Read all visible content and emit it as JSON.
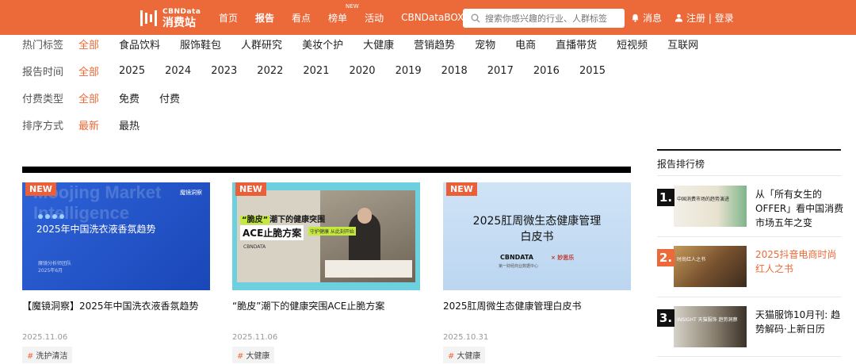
{
  "header": {
    "logo_en": "CBNData",
    "logo_cn": "消费站",
    "nav": [
      {
        "label": "首页",
        "active": false
      },
      {
        "label": "报告",
        "active": true
      },
      {
        "label": "看点",
        "active": false
      },
      {
        "label": "榜单",
        "active": false,
        "badge": "NEW"
      },
      {
        "label": "活动",
        "active": false
      },
      {
        "label": "CBNDataBOX",
        "active": false
      }
    ],
    "search_placeholder": "搜索你感兴趣的行业、人群标签",
    "messages": "消息",
    "login": "注册 | 登录"
  },
  "filters": [
    {
      "label": "热门标签",
      "options": [
        "全部",
        "食品饮料",
        "服饰鞋包",
        "人群研究",
        "美妆个护",
        "大健康",
        "营销趋势",
        "宠物",
        "电商",
        "直播带货",
        "短视频",
        "互联网"
      ],
      "selected": "全部"
    },
    {
      "label": "报告时间",
      "options": [
        "全部",
        "2025",
        "2024",
        "2023",
        "2022",
        "2021",
        "2020",
        "2019",
        "2018",
        "2017",
        "2016",
        "2015"
      ],
      "selected": "全部"
    },
    {
      "label": "付费类型",
      "options": [
        "全部",
        "免费",
        "付费"
      ],
      "selected": "全部"
    },
    {
      "label": "排序方式",
      "options": [
        "最新",
        "最热"
      ],
      "selected": "最新"
    }
  ],
  "reports": [
    {
      "badge": "NEW",
      "title": "【魔镜洞察】2025年中国洗衣液香氛趋势",
      "date": "2025.11.06",
      "tag": "洗护清洁",
      "thumb": {
        "ghost": "Moojing Market Intelligence",
        "headline": "2025年中国洗衣液香氛趋势",
        "logo": "魔镜洞察",
        "small1": "魔镜分析师团队",
        "small2": "2025年6月"
      }
    },
    {
      "badge": "NEW",
      "title": "“脆皮”潮下的健康突围ACE止脆方案",
      "date": "2025.11.06",
      "tag": "大健康",
      "thumb": {
        "line1_highlight": "“脆皮”",
        "line1_rest": "潮下的健康突围",
        "line2": "ACE止脆方案",
        "sub": "守护健康 从此刻开始",
        "brand": "CBNDATA"
      }
    },
    {
      "badge": "NEW",
      "title": "2025肛周微生态健康管理白皮书",
      "date": "2025.10.31",
      "tag": "大健康",
      "thumb": {
        "line1": "2025肛周微生态健康管理",
        "line2": "白皮书",
        "brand": "CBNDATA",
        "brand2": "×  妙思乐",
        "brand_sub": "第一财经商业数据中心"
      }
    }
  ],
  "sidebar": {
    "title": "报告排行榜",
    "items": [
      {
        "rank": "1.",
        "title": "从「所有女生的OFFER」看中国消费市场五年之变",
        "highlight": false,
        "img_text": "中国消费市场的趋势演进"
      },
      {
        "rank": "2.",
        "title": "2025抖音电商时尚红人之书",
        "highlight": true,
        "img_text": "时尚红人之书"
      },
      {
        "rank": "3.",
        "title": "天猫服饰10月刊: 趋势解码·上新日历",
        "highlight": false,
        "img_text": "INSIGHT 天猫服饰 趋势洞察"
      }
    ]
  },
  "colors": {
    "brand": "#ec6a3a",
    "badge": "#e95f39",
    "text": "#222222"
  }
}
